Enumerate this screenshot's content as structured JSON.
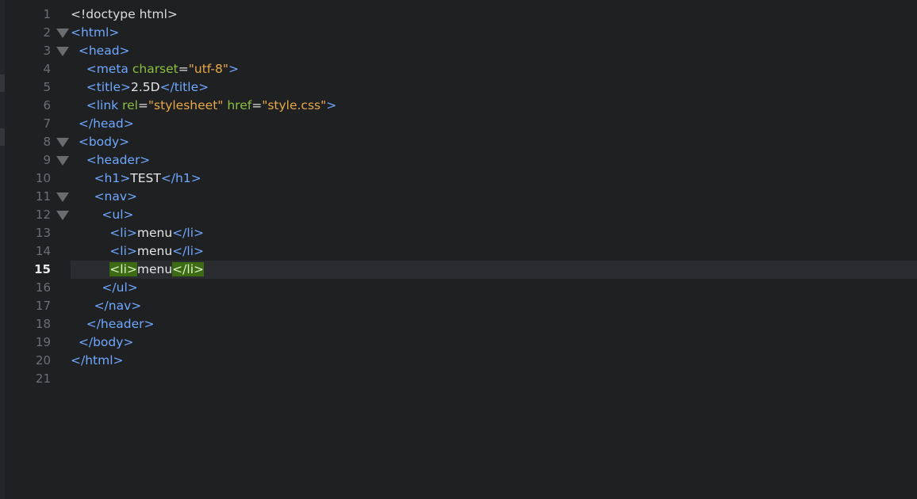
{
  "editor": {
    "current_line": 15,
    "colors": {
      "background": "#1f2022",
      "tag": "#6fa8ff",
      "attribute": "#8cbf3f",
      "string": "#e8a84a",
      "text": "#e6e6e6",
      "bracket_match": "#3b6b12"
    },
    "fold_icon": "fold-triangle-icon",
    "lines": [
      {
        "num": "1",
        "fold": false,
        "indent": "",
        "tokens": [
          {
            "t": "plain",
            "v": "<!doctype html>"
          }
        ]
      },
      {
        "num": "2",
        "fold": true,
        "indent": "",
        "tokens": [
          {
            "t": "tag",
            "v": "<html>"
          }
        ]
      },
      {
        "num": "3",
        "fold": true,
        "indent": "  ",
        "tokens": [
          {
            "t": "tag",
            "v": "<head>"
          }
        ]
      },
      {
        "num": "4",
        "fold": false,
        "indent": "    ",
        "tokens": [
          {
            "t": "tag",
            "v": "<meta "
          },
          {
            "t": "attr",
            "v": "charset"
          },
          {
            "t": "plain",
            "v": "="
          },
          {
            "t": "str",
            "v": "\"utf-8\""
          },
          {
            "t": "tag",
            "v": ">"
          }
        ]
      },
      {
        "num": "5",
        "fold": false,
        "indent": "    ",
        "tokens": [
          {
            "t": "tag",
            "v": "<title>"
          },
          {
            "t": "text",
            "v": "2.5D"
          },
          {
            "t": "tag",
            "v": "</title>"
          }
        ]
      },
      {
        "num": "6",
        "fold": false,
        "indent": "    ",
        "tokens": [
          {
            "t": "tag",
            "v": "<link "
          },
          {
            "t": "attr",
            "v": "rel"
          },
          {
            "t": "plain",
            "v": "="
          },
          {
            "t": "str",
            "v": "\"stylesheet\""
          },
          {
            "t": "plain",
            "v": " "
          },
          {
            "t": "attr",
            "v": "href"
          },
          {
            "t": "plain",
            "v": "="
          },
          {
            "t": "str",
            "v": "\"style.css\""
          },
          {
            "t": "tag",
            "v": ">"
          }
        ]
      },
      {
        "num": "7",
        "fold": false,
        "indent": "  ",
        "tokens": [
          {
            "t": "tag",
            "v": "</head>"
          }
        ]
      },
      {
        "num": "8",
        "fold": true,
        "indent": "  ",
        "tokens": [
          {
            "t": "tag",
            "v": "<body>"
          }
        ]
      },
      {
        "num": "9",
        "fold": true,
        "indent": "    ",
        "tokens": [
          {
            "t": "tag",
            "v": "<header>"
          }
        ]
      },
      {
        "num": "10",
        "fold": false,
        "indent": "      ",
        "tokens": [
          {
            "t": "tag",
            "v": "<h1>"
          },
          {
            "t": "text",
            "v": "TEST"
          },
          {
            "t": "tag",
            "v": "</h1>"
          }
        ]
      },
      {
        "num": "11",
        "fold": true,
        "indent": "      ",
        "tokens": [
          {
            "t": "tag",
            "v": "<nav>"
          }
        ]
      },
      {
        "num": "12",
        "fold": true,
        "indent": "        ",
        "tokens": [
          {
            "t": "tag",
            "v": "<ul>"
          }
        ]
      },
      {
        "num": "13",
        "fold": false,
        "indent": "          ",
        "tokens": [
          {
            "t": "tag",
            "v": "<li>"
          },
          {
            "t": "text",
            "v": "menu"
          },
          {
            "t": "tag",
            "v": "</li>"
          }
        ]
      },
      {
        "num": "14",
        "fold": false,
        "indent": "          ",
        "tokens": [
          {
            "t": "tag",
            "v": "<li>"
          },
          {
            "t": "text",
            "v": "menu"
          },
          {
            "t": "tag",
            "v": "</li>"
          }
        ]
      },
      {
        "num": "15",
        "fold": false,
        "indent": "          ",
        "tokens": [
          {
            "t": "match",
            "v": "<li>"
          },
          {
            "t": "text",
            "v": "menu"
          },
          {
            "t": "match",
            "v": "</li>"
          }
        ]
      },
      {
        "num": "16",
        "fold": false,
        "indent": "        ",
        "tokens": [
          {
            "t": "tag",
            "v": "</ul>"
          }
        ]
      },
      {
        "num": "17",
        "fold": false,
        "indent": "      ",
        "tokens": [
          {
            "t": "tag",
            "v": "</nav>"
          }
        ]
      },
      {
        "num": "18",
        "fold": false,
        "indent": "    ",
        "tokens": [
          {
            "t": "tag",
            "v": "</header>"
          }
        ]
      },
      {
        "num": "19",
        "fold": false,
        "indent": "  ",
        "tokens": [
          {
            "t": "tag",
            "v": "</body>"
          }
        ]
      },
      {
        "num": "20",
        "fold": false,
        "indent": "",
        "tokens": [
          {
            "t": "tag",
            "v": "</html>"
          }
        ]
      },
      {
        "num": "21",
        "fold": false,
        "indent": "",
        "tokens": []
      }
    ]
  }
}
